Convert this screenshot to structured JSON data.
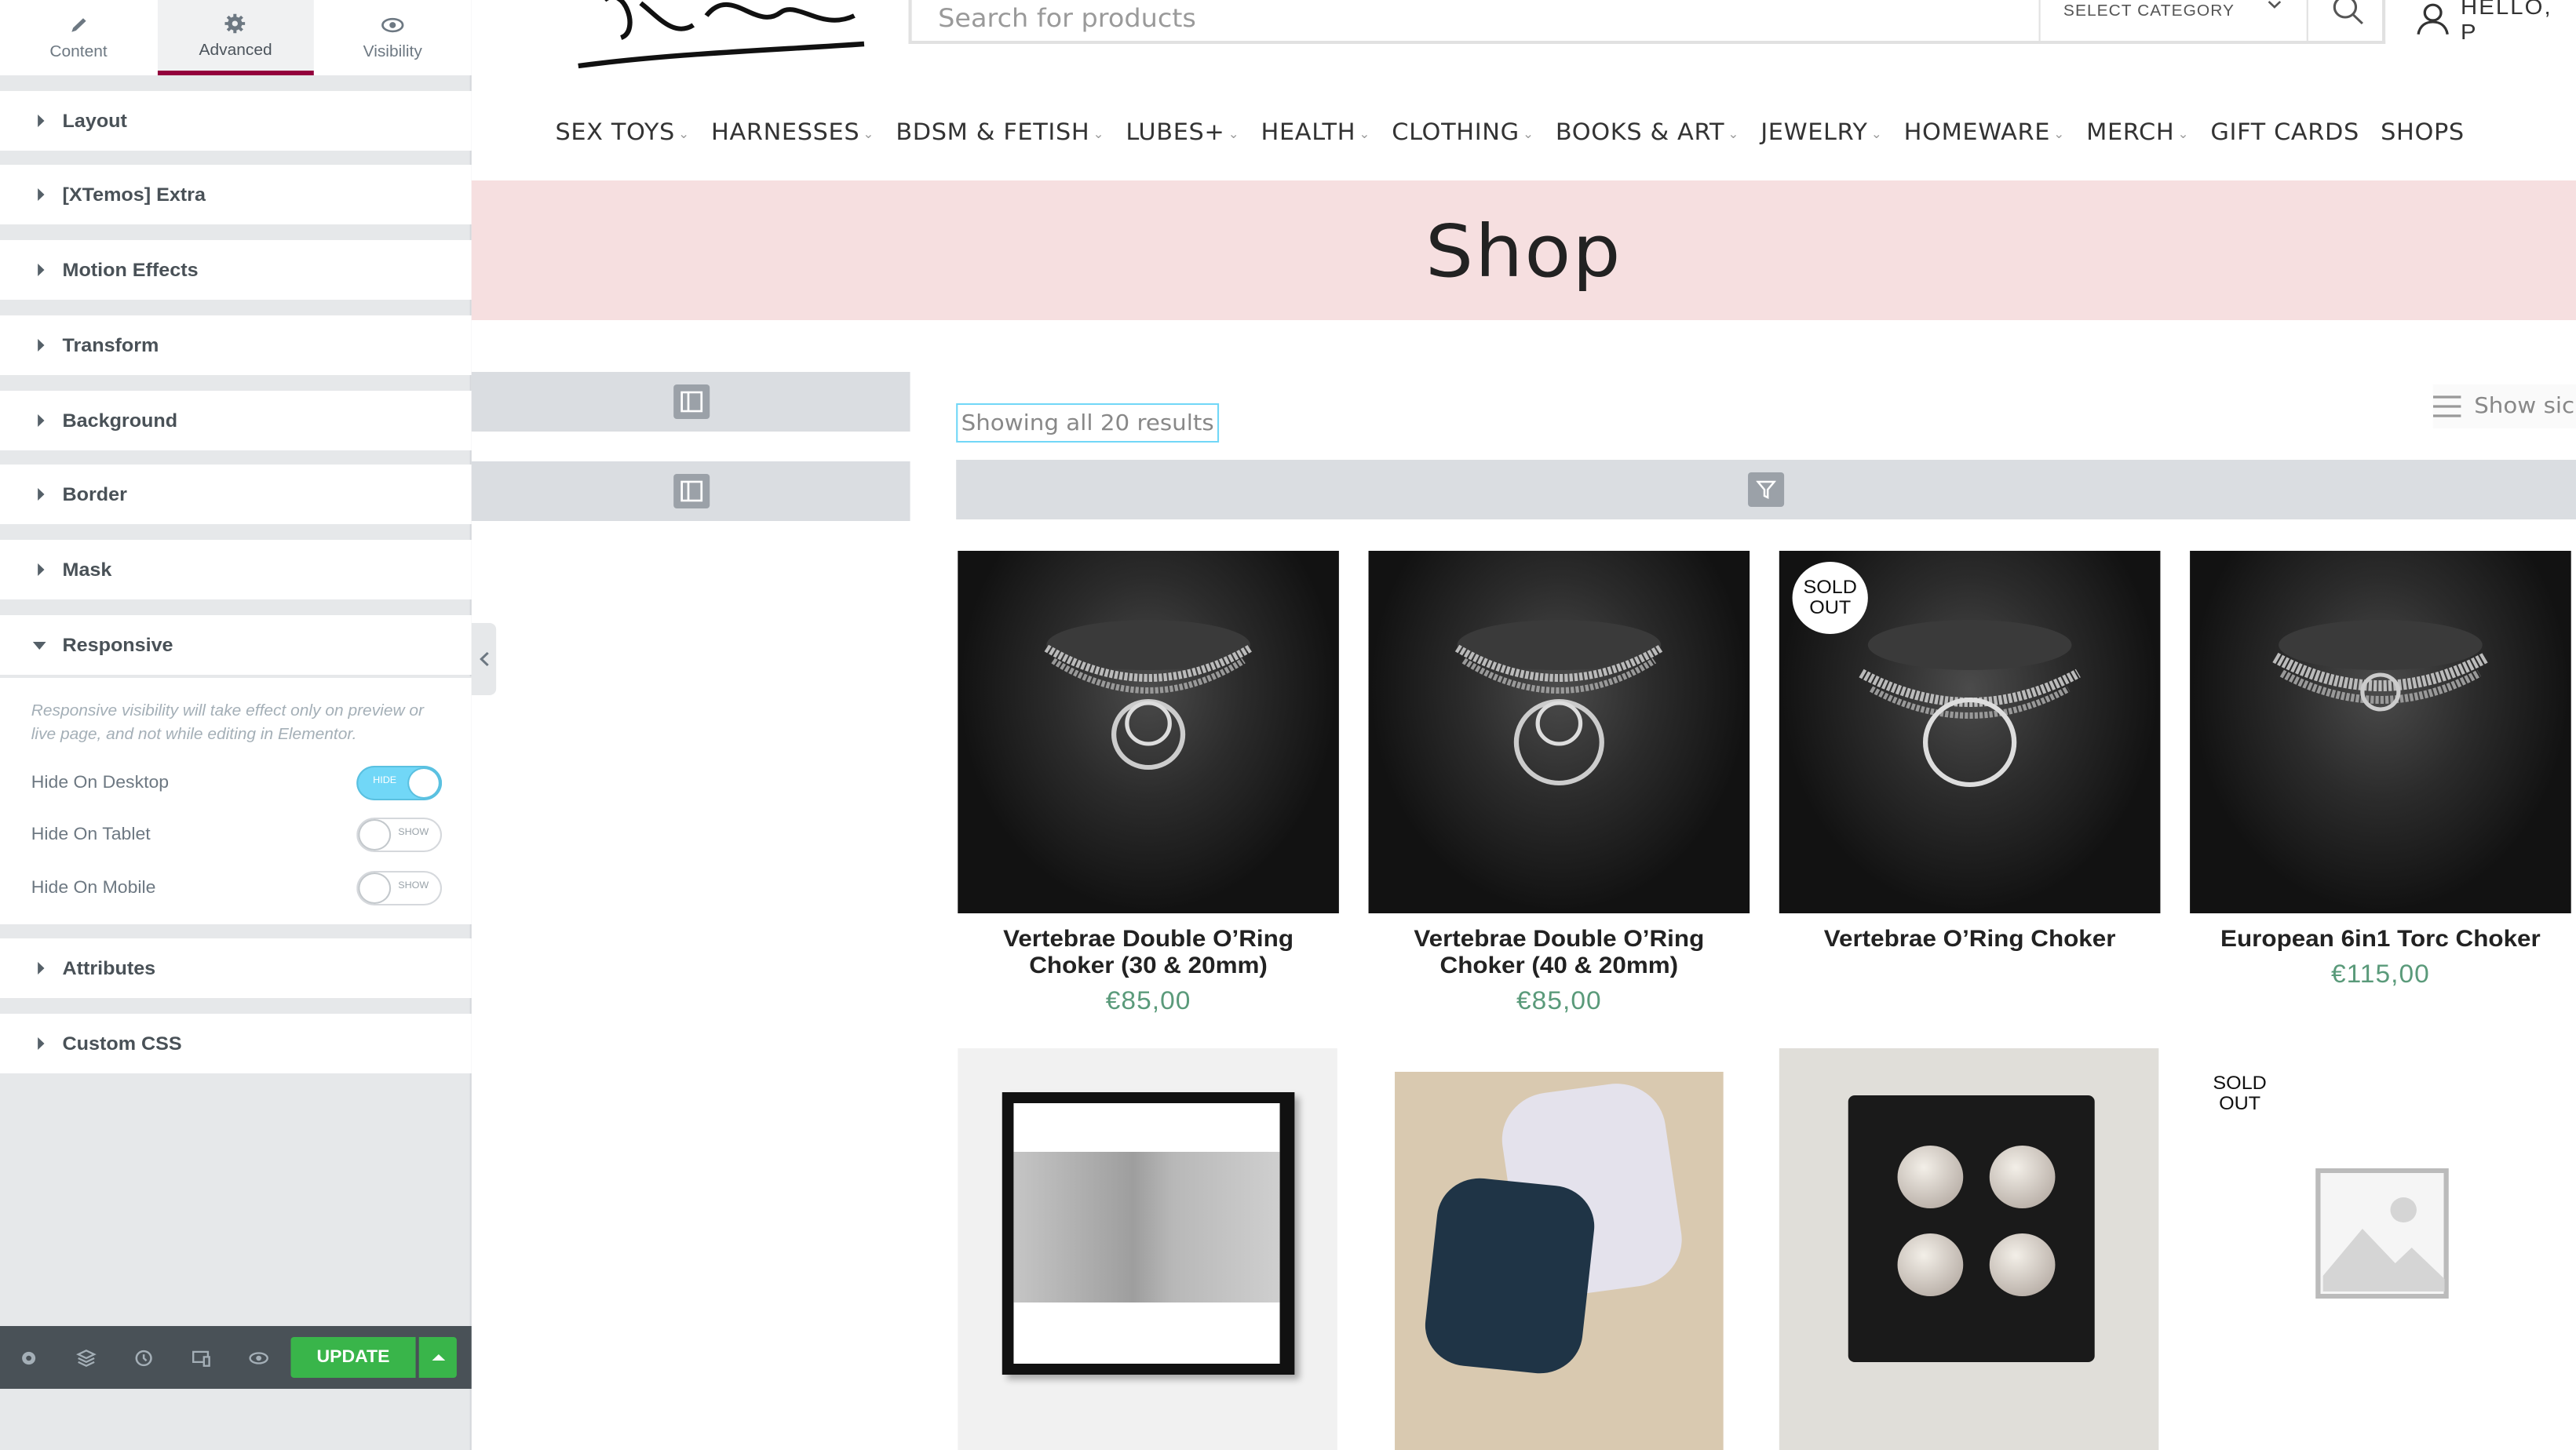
{
  "editor": {
    "tabs": [
      {
        "label": "Content",
        "icon": "pencil-icon"
      },
      {
        "label": "Advanced",
        "icon": "gear-icon"
      },
      {
        "label": "Visibility",
        "icon": "eye-icon"
      }
    ],
    "active_tab": "Advanced",
    "sections": [
      "Layout",
      "[XTemos] Extra",
      "Motion Effects",
      "Transform",
      "Background",
      "Border",
      "Mask",
      "Responsive",
      "Attributes",
      "Custom CSS"
    ],
    "responsive": {
      "note": "Responsive visibility will take effect only on preview or live page, and not while editing in Elementor.",
      "controls": [
        {
          "label": "Hide On Desktop",
          "state": "HIDE",
          "on": true
        },
        {
          "label": "Hide On Tablet",
          "state": "SHOW",
          "on": false
        },
        {
          "label": "Hide On Mobile",
          "state": "SHOW",
          "on": false
        }
      ]
    },
    "footer": {
      "icons": [
        "settings-gear-icon",
        "layers-icon",
        "history-icon",
        "responsive-mode-icon",
        "preview-eye-icon"
      ],
      "update_label": "UPDATE"
    },
    "colors": {
      "accent": "#93003c",
      "update": "#39b54a",
      "toggle_on": "#71d7f7"
    }
  },
  "site": {
    "logo_text": "Pleaso",
    "search": {
      "placeholder": "Search for products",
      "category": "SELECT CATEGORY"
    },
    "account_label": "HELLO, P",
    "nav": [
      {
        "label": "SEX TOYS",
        "has_dropdown": true
      },
      {
        "label": "HARNESSES",
        "has_dropdown": true
      },
      {
        "label": "BDSM & FETISH",
        "has_dropdown": true
      },
      {
        "label": "LUBES+",
        "has_dropdown": true
      },
      {
        "label": "HEALTH",
        "has_dropdown": true
      },
      {
        "label": "CLOTHING",
        "has_dropdown": true
      },
      {
        "label": "BOOKS & ART",
        "has_dropdown": true
      },
      {
        "label": "JEWELRY",
        "has_dropdown": true
      },
      {
        "label": "HOMEWARE",
        "has_dropdown": true
      },
      {
        "label": "MERCH",
        "has_dropdown": true
      },
      {
        "label": "GIFT CARDS",
        "has_dropdown": false
      },
      {
        "label": "SHOPS",
        "has_dropdown": false
      }
    ],
    "page_title": "Shop",
    "results_text": "Showing all 20 results",
    "show_sidebar_text": "Show sic",
    "banner_color": "#f6dfe0",
    "price_color": "#5a9a7a",
    "products": [
      {
        "title_line1": "Vertebrae Double O’Ring",
        "title_line2": "Choker (30 & 20mm)",
        "price": "€85,00",
        "sold_out": false
      },
      {
        "title_line1": "Vertebrae Double O’Ring",
        "title_line2": "Choker (40 & 20mm)",
        "price": "€85,00",
        "sold_out": false
      },
      {
        "title_line1": "Vertebrae O’Ring Choker",
        "title_line2": "",
        "price": "",
        "sold_out": true
      },
      {
        "title_line1": "European 6in1 Torc Choker",
        "title_line2": "",
        "price": "€115,00",
        "sold_out": false
      }
    ],
    "sold_out_line1": "SOLD",
    "sold_out_line2": "OUT",
    "product_row2": [
      "framed-art-print",
      "fabric-pads",
      "leather-cuff",
      "placeholder-image"
    ]
  }
}
